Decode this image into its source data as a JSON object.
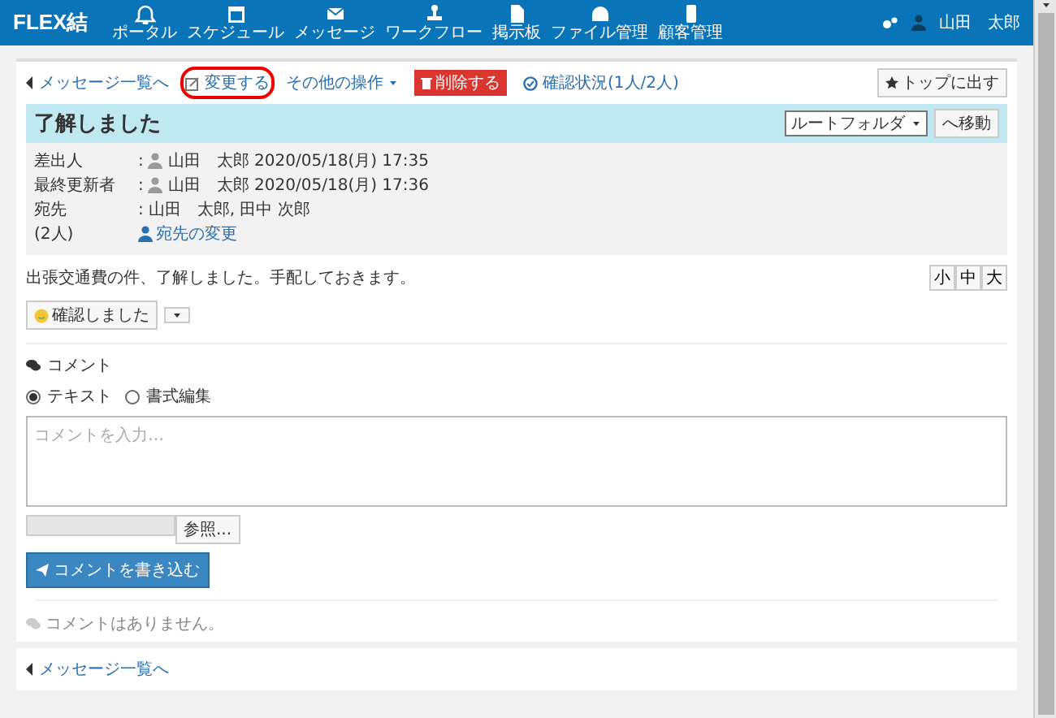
{
  "brand": "FLEX結",
  "nav": [
    {
      "label": "ポータル",
      "kind": "bell"
    },
    {
      "label": "スケジュール",
      "kind": "calendar"
    },
    {
      "label": "メッセージ",
      "kind": "mail"
    },
    {
      "label": "ワークフロー",
      "kind": "stamp"
    },
    {
      "label": "掲示板",
      "kind": "doc"
    },
    {
      "label": "ファイル管理",
      "kind": "drive"
    },
    {
      "label": "顧客管理",
      "kind": "phone"
    }
  ],
  "user": {
    "name": "山田　太郎"
  },
  "actions": [
    {
      "label": "メッセージ一覧へ",
      "kind": "back",
      "highlighted": false
    },
    {
      "label": "変更する",
      "kind": "edit",
      "highlighted": true
    },
    {
      "label": "その他の操作",
      "kind": "menu",
      "highlighted": false
    },
    {
      "label": "削除する",
      "kind": "danger",
      "highlighted": false
    },
    {
      "label": "確認状況(1人/2人)",
      "kind": "status",
      "highlighted": false
    }
  ],
  "pin_button": "トップに出す",
  "message": {
    "title": "了解しました",
    "folder": "ルートフォルダ",
    "move_button": "へ移動",
    "meta": [
      {
        "label": "差出人",
        "separator": ":",
        "value": "山田　太郎 2020/05/18(月) 17:35",
        "kind": "person"
      },
      {
        "label": "最終更新者",
        "separator": ":",
        "value": "山田　太郎 2020/05/18(月) 17:36",
        "kind": "person"
      },
      {
        "label": "宛先",
        "separator": ":",
        "value": "山田　太郎, 田中 次郎",
        "kind": "text"
      },
      {
        "label": "(2人)",
        "value": "宛先の変更",
        "kind": "link"
      }
    ],
    "body": "出張交通費の件、了解しました。手配しておきます。",
    "font_sizes": [
      {
        "label": "小",
        "selected": false
      },
      {
        "label": "中",
        "selected": false
      },
      {
        "label": "大",
        "selected": false
      }
    ],
    "confirm_button": "確認しました"
  },
  "comment": {
    "heading": "コメント",
    "modes": [
      {
        "label": "テキスト",
        "selected": true
      },
      {
        "label": "書式編集",
        "selected": false
      }
    ],
    "placeholder": "コメントを入力…",
    "browse_button": "参照...",
    "submit_button": "コメントを書き込む",
    "empty": "コメントはありません。"
  },
  "footer_link": "メッセージ一覧へ"
}
